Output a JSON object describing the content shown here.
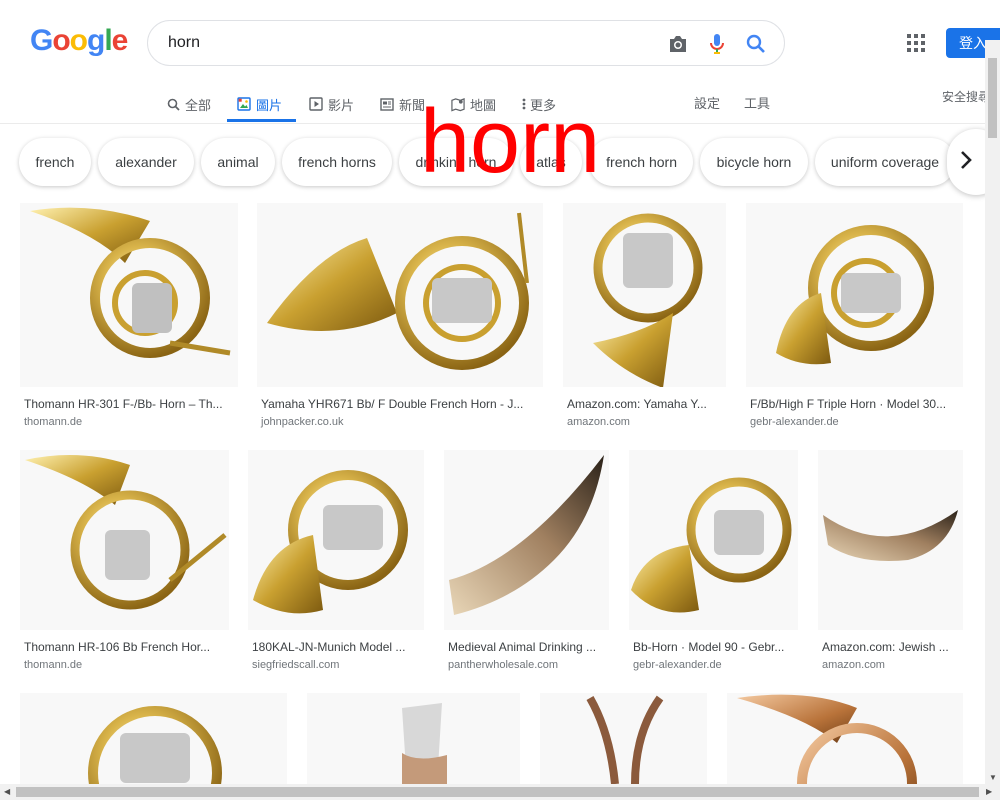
{
  "search": {
    "query": "horn"
  },
  "header": {
    "signin_label": "登入"
  },
  "tabs": [
    {
      "label": "全部",
      "icon": "search-icon"
    },
    {
      "label": "圖片",
      "icon": "image-icon",
      "active": true
    },
    {
      "label": "影片",
      "icon": "video-icon"
    },
    {
      "label": "新聞",
      "icon": "news-icon"
    },
    {
      "label": "地圖",
      "icon": "map-icon"
    },
    {
      "label": "更多",
      "icon": "more-vert-icon"
    }
  ],
  "tools": {
    "settings": "設定",
    "tools": "工具",
    "safesearch": "安全搜尋"
  },
  "chips": [
    "french",
    "alexander",
    "animal",
    "french horns",
    "drinking horn",
    "atlas",
    "french horn",
    "bicycle horn",
    "uniform coverage"
  ],
  "overlay": "horn",
  "results": [
    {
      "title": "Thomann HR-301 F-/Bb- Horn – Th...",
      "source": "thomann.de"
    },
    {
      "title": "Yamaha YHR671 Bb/ F Double French Horn - J...",
      "source": "johnpacker.co.uk"
    },
    {
      "title": "Amazon.com: Yamaha Y...",
      "source": "amazon.com"
    },
    {
      "title": "F/Bb/High F Triple Horn · Model 30...",
      "source": "gebr-alexander.de"
    },
    {
      "title": "Thomann HR-106 Bb French Hor...",
      "source": "thomann.de"
    },
    {
      "title": "180KAL-JN-Munich Model ...",
      "source": "siegfriedscall.com"
    },
    {
      "title": "Medieval Animal Drinking ...",
      "source": "pantherwholesale.com"
    },
    {
      "title": "Bb-Horn · Model 90 - Gebr...",
      "source": "gebr-alexander.de"
    },
    {
      "title": "Amazon.com: Jewish ...",
      "source": "amazon.com"
    }
  ]
}
